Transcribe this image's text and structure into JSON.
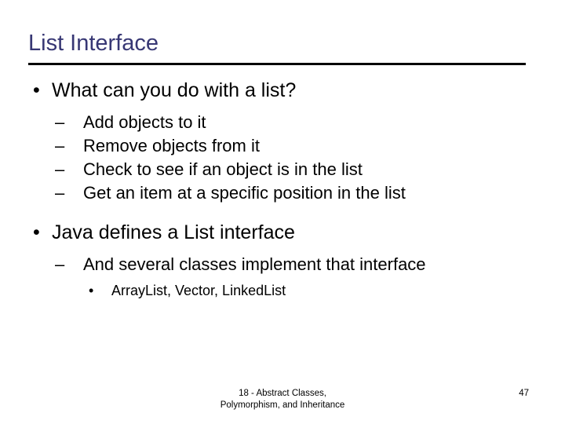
{
  "slide": {
    "title": "List Interface",
    "title_color": "#373774",
    "rule_color": "#000000",
    "background": "#ffffff",
    "body_color": "#000000",
    "markers": {
      "level1": "•",
      "level2": "–",
      "level3": "•"
    },
    "content": [
      {
        "level": 1,
        "text": "What can you do with a list?"
      },
      {
        "level": 2,
        "text": "Add objects to it"
      },
      {
        "level": 2,
        "text": "Remove objects from it"
      },
      {
        "level": 2,
        "text": "Check to see if an object is in the list"
      },
      {
        "level": 2,
        "text": "Get an item at a specific position in the list"
      },
      {
        "level": 1,
        "text": "Java defines a List interface"
      },
      {
        "level": 2,
        "text": "And several classes implement that interface"
      },
      {
        "level": 3,
        "text": "ArrayList, Vector, LinkedList"
      }
    ],
    "footer": {
      "line1": "18 - Abstract Classes,",
      "line2": "Polymorphism, and Inheritance"
    },
    "page_number": "47"
  }
}
